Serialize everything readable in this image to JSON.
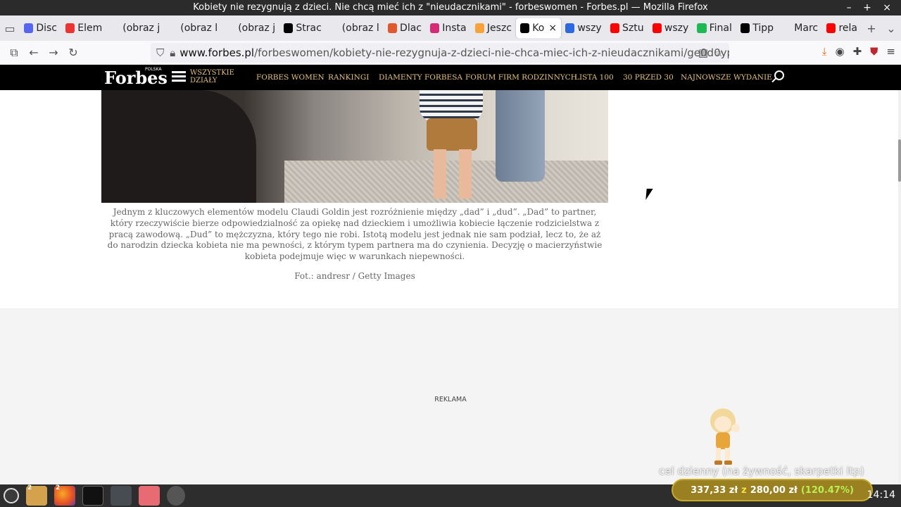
{
  "window": {
    "title": "Kobiety nie rezygnują z dzieci. Nie chcą mieć ich z \"nieudacznikami\" - forbeswomen - Forbes.pl — Mozilla Firefox",
    "controls": "– + ×"
  },
  "tabs": [
    {
      "label": "Disc",
      "color": "#5865f2"
    },
    {
      "label": "Elem",
      "color": "#e33"
    },
    {
      "label": "(obraz j",
      "color": ""
    },
    {
      "label": "(obraz l",
      "color": ""
    },
    {
      "label": "(obraz j",
      "color": ""
    },
    {
      "label": "Strac",
      "color": "#000"
    },
    {
      "label": "(obraz l",
      "color": ""
    },
    {
      "label": "Dlac",
      "color": "#e0582b"
    },
    {
      "label": "Insta",
      "color": "#d62976"
    },
    {
      "label": "Jeszc",
      "color": "#f7a33a"
    },
    {
      "label": "Ko",
      "color": "#000",
      "active": true
    },
    {
      "label": "wszy",
      "color": "#2d6ae0"
    },
    {
      "label": "Sztu",
      "color": "#f00"
    },
    {
      "label": "wszy",
      "color": "#f00"
    },
    {
      "label": "Final",
      "color": "#1db954"
    },
    {
      "label": "Tipp",
      "color": "#000"
    },
    {
      "label": "Marc",
      "color": ""
    },
    {
      "label": "rela",
      "color": "#f00"
    }
  ],
  "active_tab_close": "×",
  "url": {
    "host": "www.forbes.pl",
    "path": "/forbeswomen/kobiety-nie-rezygnuja-z-dzieci-nie-chca-miec-ich-z-nieudacznikami/ge0d0yp"
  },
  "forbes": {
    "logo": "Forbes",
    "logo_sub": "POLSKA",
    "all_departments": [
      "WSZYSTKIE",
      "DZIAŁY"
    ],
    "nav": [
      "FORBES WOMEN",
      "RANKINGI",
      "DIAMENTY FORBESA",
      "FORUM FIRM RODZINNYCH",
      "LISTA 100",
      "30 PRZED 30",
      "NAJNOWSZE WYDANIE"
    ]
  },
  "article": {
    "caption": "Jednym z kluczowych elementów modelu Claudi Goldin jest rozróżnienie między „dad” i „dud”. „Dad” to partner, który rzeczywiście bierze odpowiedzialność za opiekę nad dzieckiem i umożliwia kobiecie łączenie rodzicielstwa z pracą zawodową. „Dud” to mężczyzna, który tego nie robi. Istotą modelu jest jednak nie sam podział, lecz to, że aż do narodzin dziecka kobieta nie ma pewności, z którym typem partnera ma do czynienia. Decyzję o macierzyństwie kobieta podejmuje więc w warunkach niepewności.",
    "credit": "Fot.: andresr / Getty Images"
  },
  "ad": {
    "label": "REKLAMA"
  },
  "overlay": {
    "goal_title": "cel dzienny (na żywność, skarpetki itp)",
    "current": "337,33 zł",
    "of": "z",
    "target": "280,00 zł",
    "percent": "(120.47%)"
  },
  "taskbar": {
    "badges": [
      "2",
      "2"
    ],
    "clock": "14:14"
  }
}
